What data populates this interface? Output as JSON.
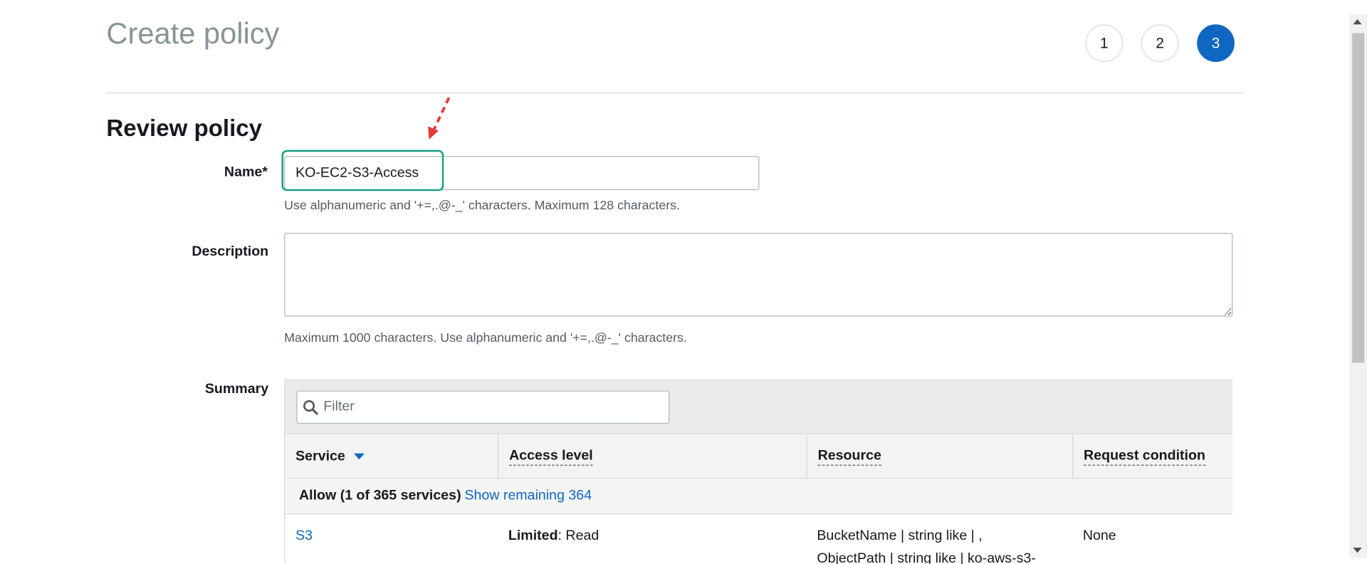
{
  "header": {
    "title": "Create policy",
    "steps": [
      "1",
      "2",
      "3"
    ],
    "active_step": "3"
  },
  "review": {
    "section_title": "Review policy",
    "name_label": "Name*",
    "name_value": "KO-EC2-S3-Access",
    "name_hint": "Use alphanumeric and '+=,.@-_' characters. Maximum 128 characters.",
    "description_label": "Description",
    "description_value": "",
    "description_hint": "Maximum 1000 characters. Use alphanumeric and '+=,.@-_' characters."
  },
  "summary": {
    "label": "Summary",
    "filter_placeholder": "Filter",
    "columns": [
      "Service",
      "Access level",
      "Resource",
      "Request condition"
    ],
    "group": {
      "label": "Allow (1 of 365 services)",
      "link": "Show remaining 364"
    },
    "rows": [
      {
        "service": "S3",
        "access_level_strong": "Limited",
        "access_level_rest": ": Read",
        "resource_line1": "BucketName | string like | ,",
        "resource_line2": "ObjectPath | string like | ko-aws-s3-",
        "condition": "None"
      }
    ]
  },
  "colors": {
    "accent": "#0f67c2",
    "highlight": "#16a085",
    "annotation_arrow": "#e53935"
  },
  "icons": {
    "filter": "search-icon",
    "sort": "caret-down-icon",
    "annotation": "dashed-arrow-icon"
  }
}
